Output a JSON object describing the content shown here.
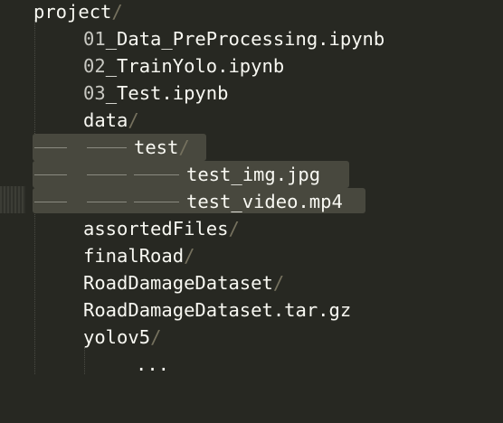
{
  "tree": {
    "root": {
      "name": "project",
      "suffix": "/"
    },
    "items": [
      {
        "prefix": "01",
        "name": "_Data_PreProcessing.ipynb",
        "suffix": ""
      },
      {
        "prefix": "02",
        "name": "_TrainYolo.ipynb",
        "suffix": ""
      },
      {
        "prefix": "03",
        "name": "_Test.ipynb",
        "suffix": ""
      },
      {
        "prefix": "",
        "name": "data",
        "suffix": "/"
      },
      {
        "prefix": "",
        "name": "test",
        "suffix": "/"
      },
      {
        "prefix": "",
        "name": "test_img.jpg",
        "suffix": ""
      },
      {
        "prefix": "",
        "name": "test_video.mp4",
        "suffix": ""
      },
      {
        "prefix": "",
        "name": "assortedFiles",
        "suffix": "/"
      },
      {
        "prefix": "",
        "name": "finalRoad",
        "suffix": "/"
      },
      {
        "prefix": "",
        "name": "RoadDamageDataset",
        "suffix": "/"
      },
      {
        "prefix": "",
        "name": "RoadDamageDataset.tar.gz",
        "suffix": ""
      },
      {
        "prefix": "",
        "name": "yolov5",
        "suffix": "/"
      }
    ],
    "ellipsis": "..."
  },
  "colors": {
    "background": "#272822",
    "text": "#f8f8f2",
    "slash": "#75715e",
    "selection": "#48483e"
  }
}
